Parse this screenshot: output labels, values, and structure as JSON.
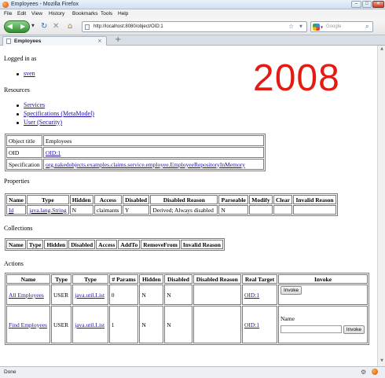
{
  "window": {
    "title": "Employees - Mozilla Firefox",
    "minimize": "–",
    "maximize": "□",
    "close": "✕"
  },
  "menu": [
    "File",
    "Edit",
    "View",
    "History",
    "Bookmarks",
    "Tools",
    "Help"
  ],
  "nav": {
    "back_icon": "◀",
    "forward_icon": "▶",
    "history_dropdown": "▼",
    "reload_icon": "↻",
    "stop_icon": "✕",
    "home_icon": "⌂",
    "url": "http://localhost:8080/object/OID:1",
    "bookmark_star": "☆",
    "url_dropdown": "▼",
    "search_placeholder": "Google",
    "search_engine_dropdown": "▼",
    "search_go": "⌕"
  },
  "tabs": {
    "active_label": "Employees",
    "close": "×",
    "new_tab": "+"
  },
  "watermark_year": "2008",
  "page": {
    "logged_in_heading": "Logged in as",
    "user": "sven",
    "resources_heading": "Resources",
    "resources": [
      "Services",
      "Specifications (MetaModel)",
      "User (Security)"
    ],
    "object_info": {
      "title_label": "Object title",
      "title_value": "Employees",
      "oid_label": "OID",
      "oid_value": "OID:1",
      "spec_label": "Specification",
      "spec_value": "org.nakedobjects.examples.claims.service.employee.EmployeeRepositoryInMemory"
    },
    "properties_heading": "Properties",
    "properties": {
      "headers": [
        "Name",
        "Type",
        "Hidden",
        "Access",
        "Disabled",
        "Disabled Reason",
        "Parseable",
        "Modify",
        "Clear",
        "Invalid Reason"
      ],
      "rows": [
        {
          "name": "Id",
          "type": "java.lang.String",
          "hidden": "N",
          "access": "claimants",
          "disabled": "Y",
          "disabled_reason": "Derived; Always disabled",
          "parseable": "N",
          "modify": "",
          "clear": "",
          "invalid_reason": ""
        }
      ]
    },
    "collections_heading": "Collections",
    "collections": {
      "headers": [
        "Name",
        "Type",
        "Hidden",
        "Disabled",
        "Access",
        "AddTo",
        "RemoveFrom",
        "Invalid Reason"
      ]
    },
    "actions_heading": "Actions",
    "actions": {
      "headers": [
        "Name",
        "Type",
        "Type",
        "# Params",
        "Hidden",
        "Disabled",
        "Disabled Reason",
        "Real Target",
        "Invoke"
      ],
      "rows": [
        {
          "name": "All Employees",
          "type": "USER",
          "return_type": "java.util.List",
          "params": "0",
          "hidden": "N",
          "disabled": "N",
          "disabled_reason": "",
          "target": "OID:1",
          "invoke": "Invoke"
        },
        {
          "name": "Find Employees",
          "type": "USER",
          "return_type": "java.util.List",
          "params": "1",
          "hidden": "N",
          "disabled": "N",
          "disabled_reason": "",
          "target": "OID:1",
          "param_label": "Name",
          "param_value": "",
          "invoke": "Invoke"
        }
      ]
    }
  },
  "status": {
    "text": "Done"
  },
  "icons": {
    "app": "firefox-icon",
    "page": "page-icon",
    "search_engine": "google-icon",
    "status_1": "addon-icon",
    "status_2": "firefox-status-icon"
  },
  "colors": {
    "watermark": "#e31b12",
    "link": "#1a0dab",
    "nav_button": "#2f8f2f"
  }
}
